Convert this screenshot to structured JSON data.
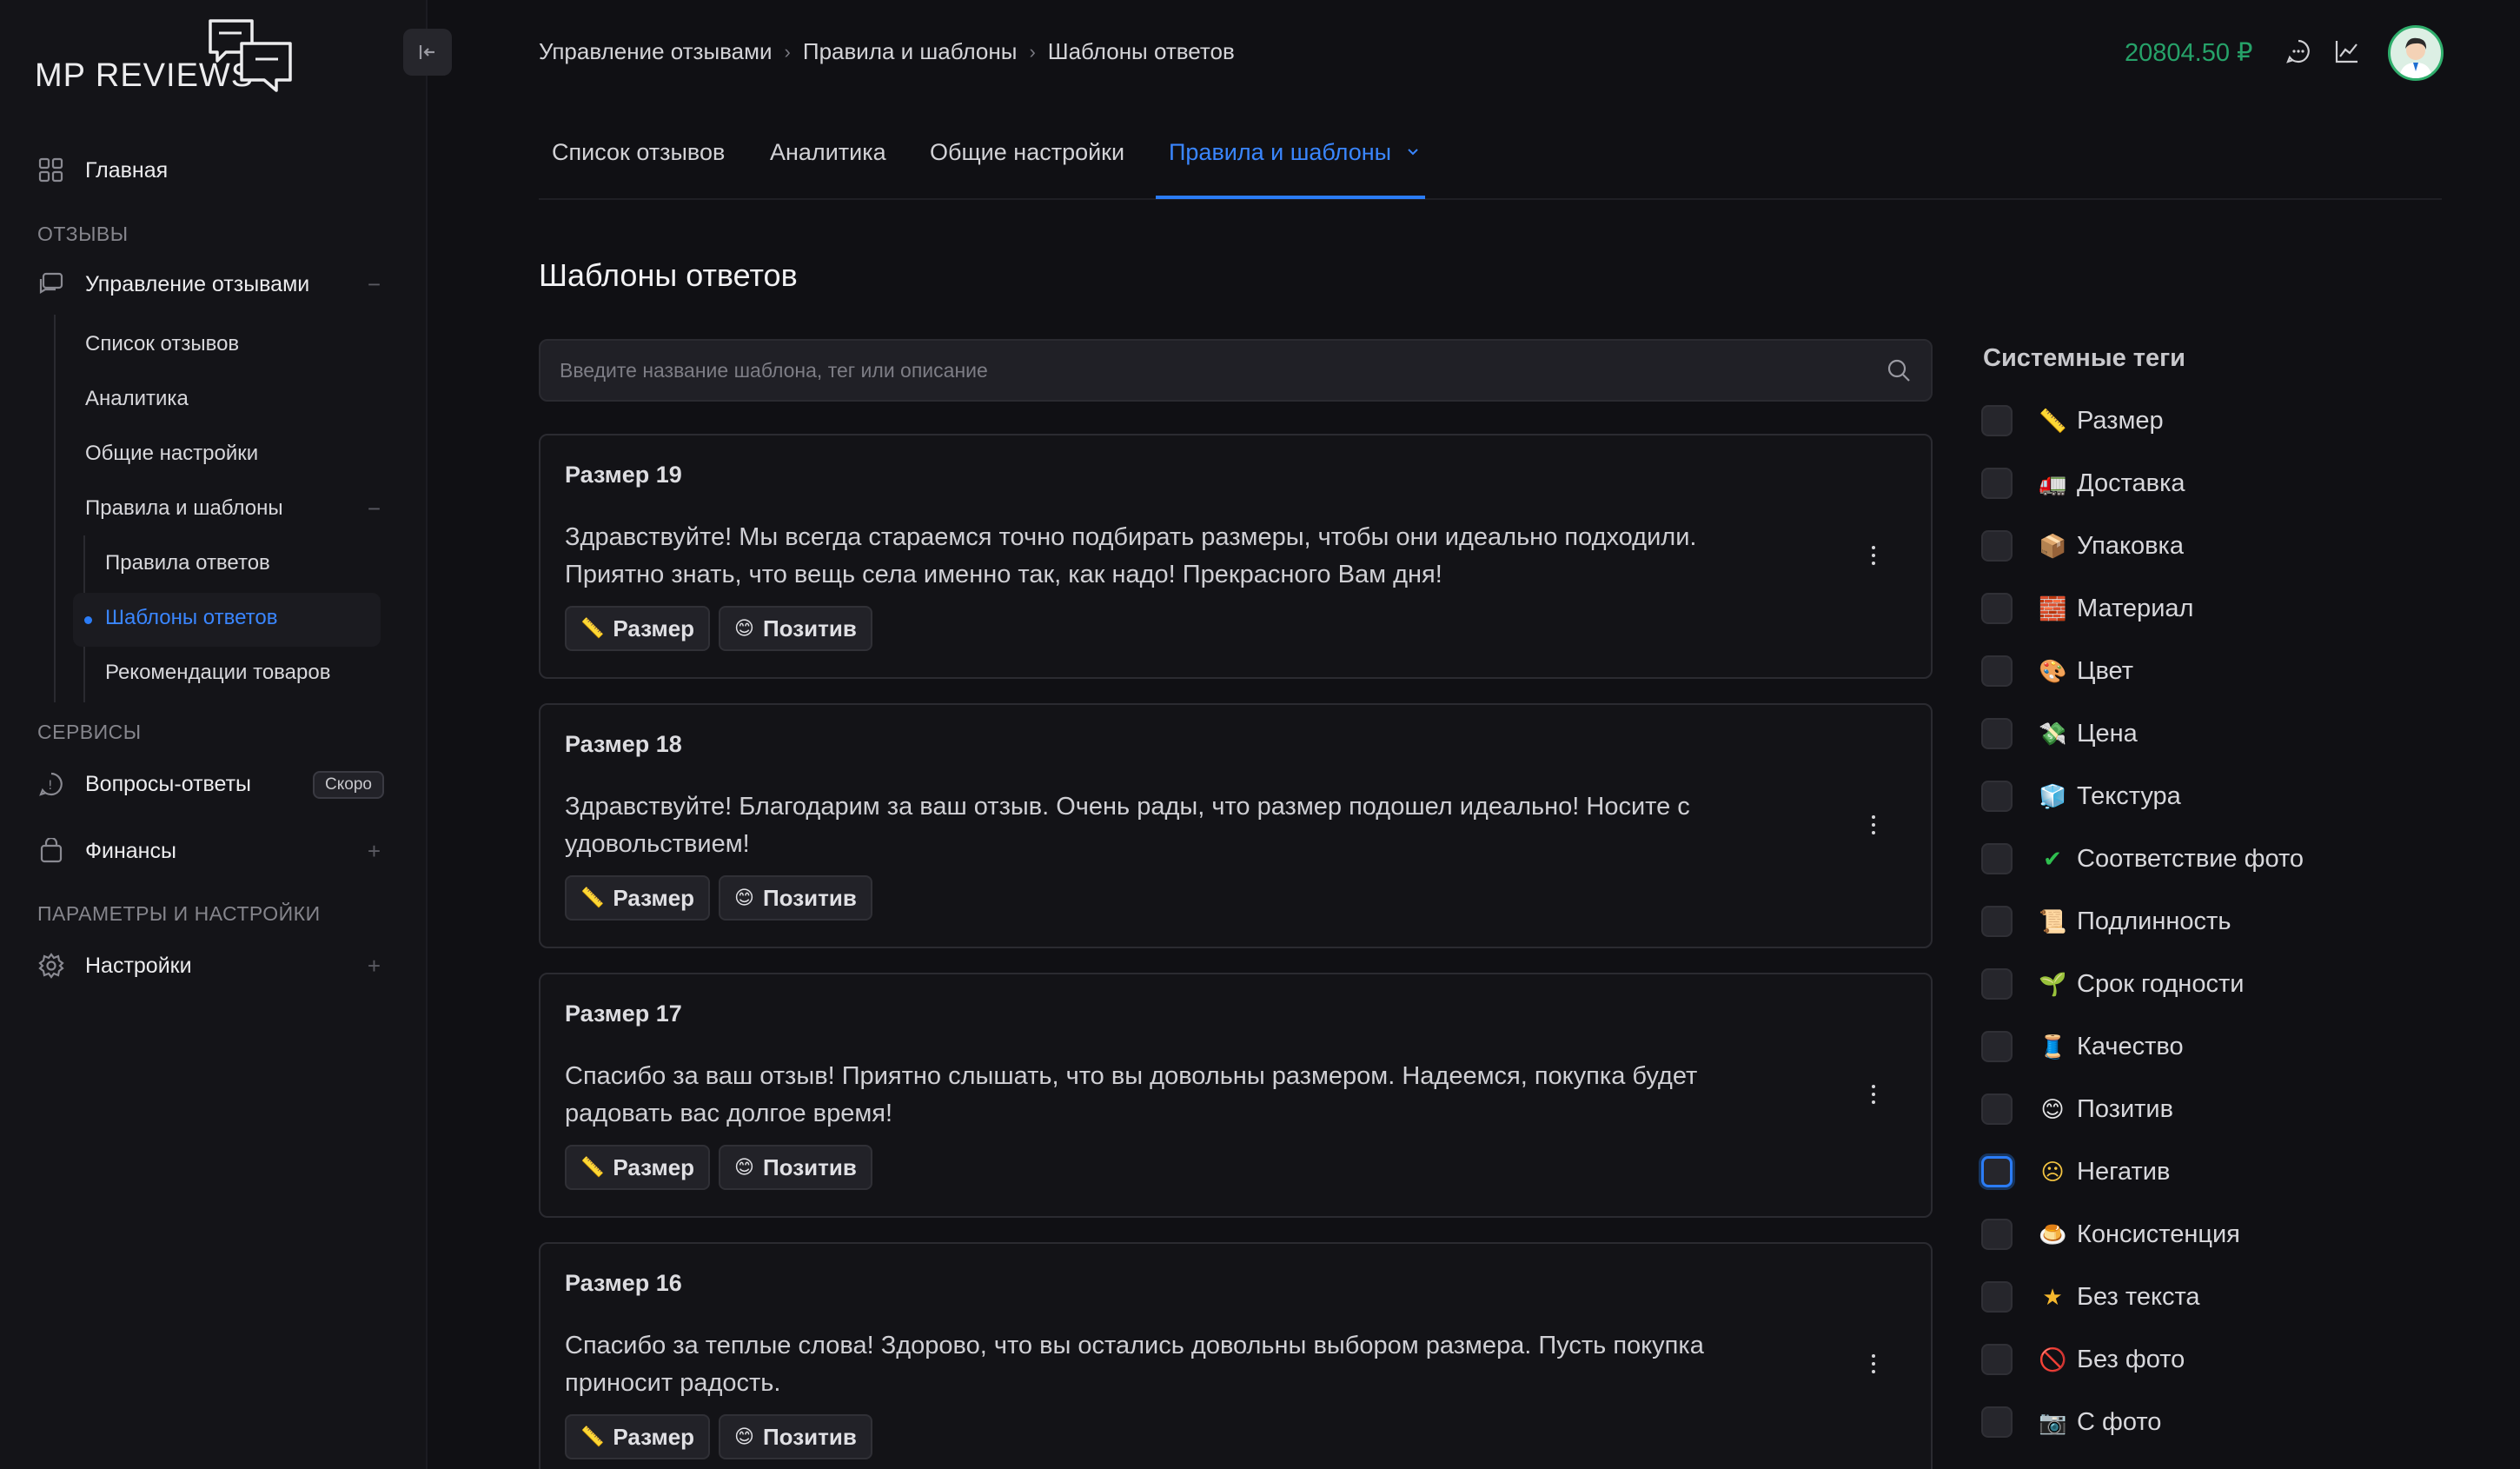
{
  "app": {
    "logo_text": "MP REVIEWS"
  },
  "sidebar": {
    "home": "Главная",
    "section_reviews": "ОТЗЫВЫ",
    "manage_reviews": "Управление отзывами",
    "sub": {
      "list": "Список отзывов",
      "analytics": "Аналитика",
      "general": "Общие настройки",
      "rules_templates": "Правила и шаблоны",
      "rules": "Правила ответов",
      "templates": "Шаблоны ответов",
      "recommendations": "Рекомендации товаров"
    },
    "section_services": "СЕРВИСЫ",
    "qa": "Вопросы-ответы",
    "soon_badge": "Скоро",
    "finance": "Финансы",
    "section_params": "ПАРАМЕТРЫ И НАСТРОЙКИ",
    "settings": "Настройки"
  },
  "breadcrumb": [
    "Управление отзывами",
    "Правила и шаблоны",
    "Шаблоны ответов"
  ],
  "header": {
    "balance": "20804.50 ₽"
  },
  "tabs": [
    "Список отзывов",
    "Аналитика",
    "Общие настройки",
    "Правила и шаблоны"
  ],
  "page_title": "Шаблоны ответов",
  "search": {
    "placeholder": "Введите название шаблона, тег или описание",
    "value": ""
  },
  "templates": [
    {
      "title": "Размер 19",
      "text": "Здравствуйте! Мы всегда стараемся точно подбирать размеры, чтобы они идеально подходили. Приятно знать, что вещь села именно так, как надо! Прекрасного Вам дня!",
      "tags": [
        {
          "emoji": "📏",
          "label": "Размер"
        },
        {
          "emoji": "😊",
          "label": "Позитив"
        }
      ]
    },
    {
      "title": "Размер 18",
      "text": "Здравствуйте! Благодарим за ваш отзыв. Очень рады, что размер подошел идеально! Носите с удовольствием!",
      "tags": [
        {
          "emoji": "📏",
          "label": "Размер"
        },
        {
          "emoji": "😊",
          "label": "Позитив"
        }
      ]
    },
    {
      "title": "Размер 17",
      "text": "Спасибо за ваш отзыв! Приятно слышать, что вы довольны размером. Надеемся, покупка будет радовать вас долгое время!",
      "tags": [
        {
          "emoji": "📏",
          "label": "Размер"
        },
        {
          "emoji": "😊",
          "label": "Позитив"
        }
      ]
    },
    {
      "title": "Размер 16",
      "text": "Спасибо за теплые слова! Здорово, что вы остались довольны выбором размера. Пусть покупка приносит радость.",
      "tags": [
        {
          "emoji": "📏",
          "label": "Размер"
        },
        {
          "emoji": "😊",
          "label": "Позитив"
        }
      ]
    }
  ],
  "system_tags_title": "Системные теги",
  "system_tags": [
    {
      "emoji": "📏",
      "label": "Размер"
    },
    {
      "emoji": "🚛",
      "label": "Доставка"
    },
    {
      "emoji": "📦",
      "label": "Упаковка"
    },
    {
      "emoji": "🧱",
      "label": "Материал"
    },
    {
      "emoji": "🎨",
      "label": "Цвет"
    },
    {
      "emoji": "💸",
      "label": "Цена"
    },
    {
      "emoji": "🧊",
      "label": "Текстура"
    },
    {
      "emoji": "✔",
      "label": "Соответствие фото"
    },
    {
      "emoji": "📜",
      "label": "Подлинность"
    },
    {
      "emoji": "🌱",
      "label": "Срок годности"
    },
    {
      "emoji": "🧵",
      "label": "Качество"
    },
    {
      "emoji": "😊",
      "label": "Позитив"
    },
    {
      "emoji": "☹",
      "label": "Негатив"
    },
    {
      "emoji": "🍮",
      "label": "Консистенция"
    },
    {
      "emoji": "★",
      "label": "Без текста"
    },
    {
      "emoji": "🚫",
      "label": "Без фото"
    },
    {
      "emoji": "📷",
      "label": "С фото"
    }
  ],
  "colors": {
    "accent": "#2b7cf6",
    "balance": "#26a269",
    "background": "#101014"
  }
}
